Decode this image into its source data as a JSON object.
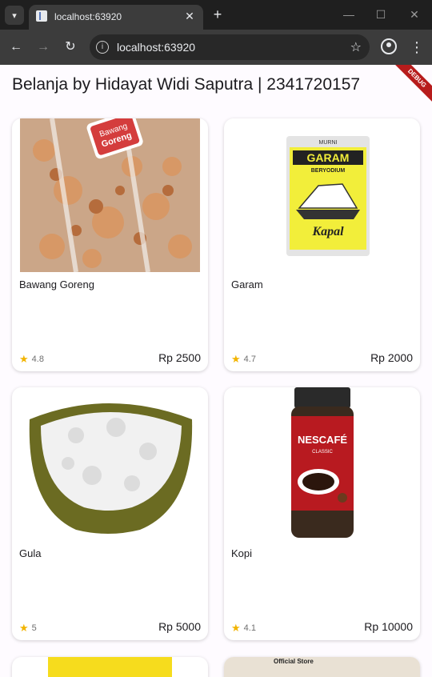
{
  "browser": {
    "tab_title": "localhost:63920",
    "url": "localhost:63920"
  },
  "app": {
    "title": "Belanja by Hidayat Widi Saputra | 2341720157",
    "debug_label": "DEBUG"
  },
  "products": [
    {
      "name": "Bawang Goreng",
      "rating": "4.8",
      "price": "Rp 2500",
      "image": "fried-shallot-package"
    },
    {
      "name": "Garam",
      "rating": "4.7",
      "price": "Rp 2000",
      "image": "salt-package",
      "package_text": {
        "brand": "MURNI",
        "title": "GARAM",
        "subtitle": "BERYODIUM",
        "logo": "Kapal"
      }
    },
    {
      "name": "Gula",
      "rating": "5",
      "price": "Rp 5000",
      "image": "sugar-bowl"
    },
    {
      "name": "Kopi",
      "rating": "4.1",
      "price": "Rp 10000",
      "image": "coffee-jar",
      "package_text": {
        "brand": "NESCAFÉ",
        "subtitle": "CLASSIC"
      }
    }
  ],
  "peek_text": {
    "right": "Official Store"
  }
}
